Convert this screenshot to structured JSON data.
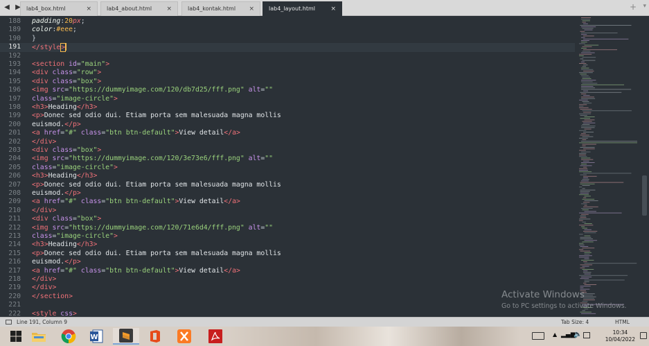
{
  "tabs": [
    {
      "label": "lab4_box.html",
      "active": false
    },
    {
      "label": "lab4_about.html",
      "active": false
    },
    {
      "label": "lab4_kontak.html",
      "active": false
    },
    {
      "label": "lab4_layout.html",
      "active": true
    }
  ],
  "tab_close_glyph": "×",
  "nav": {
    "back": "◀",
    "forward": "▶"
  },
  "new_tab_glyph": "+",
  "tab_menu_glyph": "▾",
  "editor": {
    "current_line": 191,
    "lines": [
      {
        "n": "188",
        "tokens": [
          [
            "prop",
            "padding"
          ],
          [
            "punc",
            ":"
          ],
          [
            "num",
            "20"
          ],
          [
            "unit",
            "px"
          ],
          [
            "punc",
            ";"
          ]
        ]
      },
      {
        "n": "189",
        "tokens": [
          [
            "prop",
            "color"
          ],
          [
            "punc",
            ":"
          ],
          [
            "num",
            "#eee"
          ],
          [
            "punc",
            ";"
          ]
        ]
      },
      {
        "n": "190",
        "tokens": [
          [
            "punc",
            "}"
          ]
        ]
      },
      {
        "n": "191",
        "tokens": [
          [
            "tag",
            "</"
          ],
          [
            "tag",
            "style"
          ],
          [
            "tag",
            ">"
          ]
        ],
        "cursor": true
      },
      {
        "n": "192",
        "tokens": []
      },
      {
        "n": "193",
        "tokens": [
          [
            "tag",
            "<"
          ],
          [
            "tag",
            "section "
          ],
          [
            "attr",
            "id"
          ],
          [
            "punc",
            "="
          ],
          [
            "str",
            "\"main\""
          ],
          [
            "tag",
            ">"
          ]
        ]
      },
      {
        "n": "194",
        "tokens": [
          [
            "tag",
            "<"
          ],
          [
            "tag",
            "div "
          ],
          [
            "attr",
            "class"
          ],
          [
            "punc",
            "="
          ],
          [
            "str",
            "\"row\""
          ],
          [
            "tag",
            ">"
          ]
        ]
      },
      {
        "n": "195",
        "tokens": [
          [
            "tag",
            "<"
          ],
          [
            "tag",
            "div "
          ],
          [
            "attr",
            "class"
          ],
          [
            "punc",
            "="
          ],
          [
            "str",
            "\"box\""
          ],
          [
            "tag",
            ">"
          ]
        ]
      },
      {
        "n": "196",
        "tokens": [
          [
            "tag",
            "<"
          ],
          [
            "tag",
            "img "
          ],
          [
            "attr",
            "src"
          ],
          [
            "punc",
            "="
          ],
          [
            "str",
            "\"https://dummyimage.com/120/db7d25/fff.png\""
          ],
          [
            "text",
            " "
          ],
          [
            "attr",
            "alt"
          ],
          [
            "punc",
            "="
          ],
          [
            "str",
            "\"\""
          ]
        ]
      },
      {
        "n": "197",
        "tokens": [
          [
            "attr",
            "class"
          ],
          [
            "punc",
            "="
          ],
          [
            "str",
            "\"image-circle\""
          ],
          [
            "tag",
            ">"
          ]
        ]
      },
      {
        "n": "198",
        "tokens": [
          [
            "tag",
            "<"
          ],
          [
            "tag",
            "h3"
          ],
          [
            "tag",
            ">"
          ],
          [
            "text",
            "Heading"
          ],
          [
            "tag",
            "</"
          ],
          [
            "tag",
            "h3"
          ],
          [
            "tag",
            ">"
          ]
        ]
      },
      {
        "n": "199",
        "tokens": [
          [
            "tag",
            "<"
          ],
          [
            "tag",
            "p"
          ],
          [
            "tag",
            ">"
          ],
          [
            "text",
            "Donec sed odio dui. Etiam porta sem malesuada magna mollis"
          ]
        ]
      },
      {
        "n": "200",
        "tokens": [
          [
            "text",
            "euismod."
          ],
          [
            "tag",
            "</"
          ],
          [
            "tag",
            "p"
          ],
          [
            "tag",
            ">"
          ]
        ]
      },
      {
        "n": "201",
        "tokens": [
          [
            "tag",
            "<"
          ],
          [
            "tag",
            "a "
          ],
          [
            "attr",
            "href"
          ],
          [
            "punc",
            "="
          ],
          [
            "str",
            "\"#\""
          ],
          [
            "text",
            " "
          ],
          [
            "attr",
            "class"
          ],
          [
            "punc",
            "="
          ],
          [
            "str",
            "\"btn btn-default\""
          ],
          [
            "tag",
            ">"
          ],
          [
            "text",
            "View detail"
          ],
          [
            "tag",
            "</"
          ],
          [
            "tag",
            "a"
          ],
          [
            "tag",
            ">"
          ]
        ]
      },
      {
        "n": "202",
        "tokens": [
          [
            "tag",
            "</"
          ],
          [
            "tag",
            "div"
          ],
          [
            "tag",
            ">"
          ]
        ]
      },
      {
        "n": "203",
        "tokens": [
          [
            "tag",
            "<"
          ],
          [
            "tag",
            "div "
          ],
          [
            "attr",
            "class"
          ],
          [
            "punc",
            "="
          ],
          [
            "str",
            "\"box\""
          ],
          [
            "tag",
            ">"
          ]
        ]
      },
      {
        "n": "204",
        "tokens": [
          [
            "tag",
            "<"
          ],
          [
            "tag",
            "img "
          ],
          [
            "attr",
            "src"
          ],
          [
            "punc",
            "="
          ],
          [
            "str",
            "\"https://dummyimage.com/120/3e73e6/fff.png\""
          ],
          [
            "text",
            " "
          ],
          [
            "attr",
            "alt"
          ],
          [
            "punc",
            "="
          ],
          [
            "str",
            "\"\""
          ]
        ]
      },
      {
        "n": "205",
        "tokens": [
          [
            "attr",
            "class"
          ],
          [
            "punc",
            "="
          ],
          [
            "str",
            "\"image-circle\""
          ],
          [
            "tag",
            ">"
          ]
        ]
      },
      {
        "n": "206",
        "tokens": [
          [
            "tag",
            "<"
          ],
          [
            "tag",
            "h3"
          ],
          [
            "tag",
            ">"
          ],
          [
            "text",
            "Heading"
          ],
          [
            "tag",
            "</"
          ],
          [
            "tag",
            "h3"
          ],
          [
            "tag",
            ">"
          ]
        ]
      },
      {
        "n": "207",
        "tokens": [
          [
            "tag",
            "<"
          ],
          [
            "tag",
            "p"
          ],
          [
            "tag",
            ">"
          ],
          [
            "text",
            "Donec sed odio dui. Etiam porta sem malesuada magna mollis"
          ]
        ]
      },
      {
        "n": "208",
        "tokens": [
          [
            "text",
            "euismod."
          ],
          [
            "tag",
            "</"
          ],
          [
            "tag",
            "p"
          ],
          [
            "tag",
            ">"
          ]
        ]
      },
      {
        "n": "209",
        "tokens": [
          [
            "tag",
            "<"
          ],
          [
            "tag",
            "a "
          ],
          [
            "attr",
            "href"
          ],
          [
            "punc",
            "="
          ],
          [
            "str",
            "\"#\""
          ],
          [
            "text",
            " "
          ],
          [
            "attr",
            "class"
          ],
          [
            "punc",
            "="
          ],
          [
            "str",
            "\"btn btn-default\""
          ],
          [
            "tag",
            ">"
          ],
          [
            "text",
            "View detail"
          ],
          [
            "tag",
            "</"
          ],
          [
            "tag",
            "a"
          ],
          [
            "tag",
            ">"
          ]
        ]
      },
      {
        "n": "210",
        "tokens": [
          [
            "tag",
            "</"
          ],
          [
            "tag",
            "div"
          ],
          [
            "tag",
            ">"
          ]
        ]
      },
      {
        "n": "211",
        "tokens": [
          [
            "tag",
            "<"
          ],
          [
            "tag",
            "div "
          ],
          [
            "attr",
            "class"
          ],
          [
            "punc",
            "="
          ],
          [
            "str",
            "\"box\""
          ],
          [
            "tag",
            ">"
          ]
        ]
      },
      {
        "n": "212",
        "tokens": [
          [
            "tag",
            "<"
          ],
          [
            "tag",
            "img "
          ],
          [
            "attr",
            "src"
          ],
          [
            "punc",
            "="
          ],
          [
            "str",
            "\"https://dummyimage.com/120/71e6d4/fff.png\""
          ],
          [
            "text",
            " "
          ],
          [
            "attr",
            "alt"
          ],
          [
            "punc",
            "="
          ],
          [
            "str",
            "\"\""
          ]
        ]
      },
      {
        "n": "213",
        "tokens": [
          [
            "attr",
            "class"
          ],
          [
            "punc",
            "="
          ],
          [
            "str",
            "\"image-circle\""
          ],
          [
            "tag",
            ">"
          ]
        ]
      },
      {
        "n": "214",
        "tokens": [
          [
            "tag",
            "<"
          ],
          [
            "tag",
            "h3"
          ],
          [
            "tag",
            ">"
          ],
          [
            "text",
            "Heading"
          ],
          [
            "tag",
            "</"
          ],
          [
            "tag",
            "h3"
          ],
          [
            "tag",
            ">"
          ]
        ]
      },
      {
        "n": "215",
        "tokens": [
          [
            "tag",
            "<"
          ],
          [
            "tag",
            "p"
          ],
          [
            "tag",
            ">"
          ],
          [
            "text",
            "Donec sed odio dui. Etiam porta sem malesuada magna mollis"
          ]
        ]
      },
      {
        "n": "216",
        "tokens": [
          [
            "text",
            "euismod."
          ],
          [
            "tag",
            "</"
          ],
          [
            "tag",
            "p"
          ],
          [
            "tag",
            ">"
          ]
        ]
      },
      {
        "n": "217",
        "tokens": [
          [
            "tag",
            "<"
          ],
          [
            "tag",
            "a "
          ],
          [
            "attr",
            "href"
          ],
          [
            "punc",
            "="
          ],
          [
            "str",
            "\"#\""
          ],
          [
            "text",
            " "
          ],
          [
            "attr",
            "class"
          ],
          [
            "punc",
            "="
          ],
          [
            "str",
            "\"btn btn-default\""
          ],
          [
            "tag",
            ">"
          ],
          [
            "text",
            "View detail"
          ],
          [
            "tag",
            "</"
          ],
          [
            "tag",
            "a"
          ],
          [
            "tag",
            ">"
          ]
        ]
      },
      {
        "n": "218",
        "tokens": [
          [
            "tag",
            "</"
          ],
          [
            "tag",
            "div"
          ],
          [
            "tag",
            ">"
          ]
        ]
      },
      {
        "n": "219",
        "tokens": [
          [
            "tag",
            "</"
          ],
          [
            "tag",
            "div"
          ],
          [
            "tag",
            ">"
          ]
        ]
      },
      {
        "n": "220",
        "tokens": [
          [
            "tag",
            "</"
          ],
          [
            "tag",
            "section"
          ],
          [
            "tag",
            ">"
          ]
        ]
      },
      {
        "n": "221",
        "tokens": []
      },
      {
        "n": "222",
        "tokens": [
          [
            "tag",
            "<"
          ],
          [
            "tag",
            "style "
          ],
          [
            "attr",
            "css"
          ],
          [
            "tag",
            ">"
          ]
        ]
      }
    ]
  },
  "watermark": {
    "title": "Activate Windows",
    "subtitle": "Go to PC settings to activate Windows."
  },
  "status": {
    "position": "Line 191, Column 9",
    "tab_size": "Tab Size: 4",
    "syntax": "HTML"
  },
  "taskbar": {
    "apps": [
      {
        "name": "windows-start",
        "active": false
      },
      {
        "name": "file-explorer",
        "active": false
      },
      {
        "name": "chrome",
        "active": false
      },
      {
        "name": "word",
        "active": false
      },
      {
        "name": "sublime-text",
        "active": true
      },
      {
        "name": "office",
        "active": false
      },
      {
        "name": "xampp",
        "active": false
      },
      {
        "name": "acrobat",
        "active": false
      }
    ],
    "time": "10:34",
    "date": "10/04/2022"
  },
  "colors": {
    "editor_bg": "#2b3137",
    "tag": "#f07178",
    "attr": "#c792ea",
    "string": "#9ad27c",
    "number": "#f7b94f"
  }
}
